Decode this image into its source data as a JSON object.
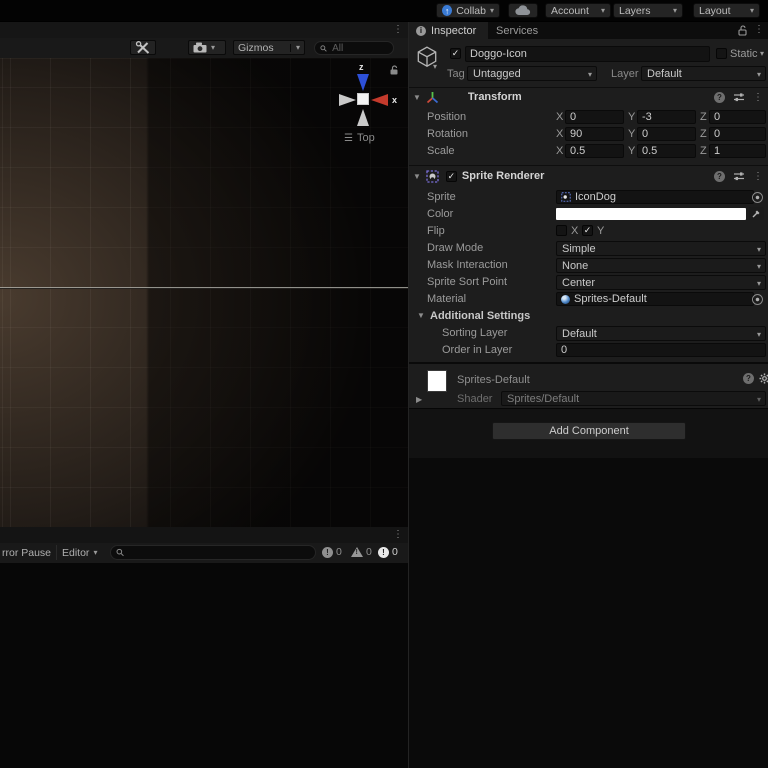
{
  "toolbar": {
    "collab": "Collab",
    "account": "Account",
    "layers": "Layers",
    "layout": "Layout"
  },
  "scene": {
    "gizmos_label": "Gizmos",
    "search_placeholder": "All",
    "view_gizmo": {
      "z": "z",
      "x": "x",
      "view_label": "Top"
    }
  },
  "inspector": {
    "tabs": [
      {
        "label": "Inspector"
      },
      {
        "label": "Services"
      }
    ],
    "header": {
      "name": "Doggo-Icon",
      "static_label": "Static",
      "tag_label": "Tag",
      "tag_value": "Untagged",
      "layer_label": "Layer",
      "layer_value": "Default"
    },
    "transform": {
      "title": "Transform",
      "axis_x": "X",
      "axis_y": "Y",
      "axis_z": "Z",
      "rows": [
        {
          "label": "Position",
          "x": "0",
          "y": "-3",
          "z": "0"
        },
        {
          "label": "Rotation",
          "x": "90",
          "y": "0",
          "z": "0"
        },
        {
          "label": "Scale",
          "x": "0.5",
          "y": "0.5",
          "z": "1"
        }
      ]
    },
    "sprite_renderer": {
      "title": "Sprite Renderer",
      "sprite_label": "Sprite",
      "sprite_value": "IconDog",
      "color_label": "Color",
      "flip_label": "Flip",
      "flip_x": "X",
      "flip_y": "Y",
      "draw_mode_label": "Draw Mode",
      "draw_mode_value": "Simple",
      "mask_label": "Mask Interaction",
      "mask_value": "None",
      "sort_point_label": "Sprite Sort Point",
      "sort_point_value": "Center",
      "material_label": "Material",
      "material_value": "Sprites-Default",
      "additional_label": "Additional Settings",
      "sorting_layer_label": "Sorting Layer",
      "sorting_layer_value": "Default",
      "order_label": "Order in Layer",
      "order_value": "0"
    },
    "material_footer": {
      "title": "Sprites-Default",
      "shader_label": "Shader",
      "shader_value": "Sprites/Default"
    },
    "add_component_label": "Add Component"
  },
  "console": {
    "error_pause_label": "rror Pause",
    "editor_label": "Editor",
    "info_count": "0",
    "warning_count": "0",
    "error_count": "0"
  },
  "colors": {
    "collab_blue": "#3a7bd5",
    "axis_x_red": "#c43a2c",
    "axis_z_blue": "#2d50d8",
    "warm_glow": "#4a3c32"
  }
}
